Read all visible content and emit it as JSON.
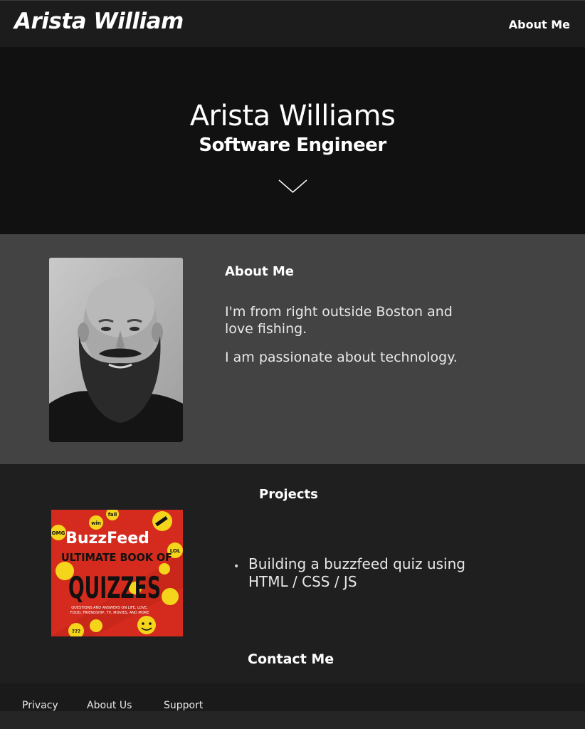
{
  "navbar": {
    "brand": "Arista William",
    "link": "About Me"
  },
  "hero": {
    "name": "Arista Williams",
    "role": "Software Engineer"
  },
  "about": {
    "title": "About Me",
    "paragraph_1": "I'm from right outside Boston and love fishing.",
    "paragraph_2": "I am passionate about technology."
  },
  "projects": {
    "title": "Projects",
    "items": [
      "Building a buzzfeed quiz using HTML / CSS / JS"
    ],
    "book": {
      "brand": "BuzzFeed",
      "line1": "ULTIMATE BOOK OF",
      "line2": "QUIZZES",
      "subtitle_1": "QUESTIONS AND ANSWERS ON LIFE, LOVE,",
      "subtitle_2": "FOOD, FRIENDSHIP, TV, MOVIES, AND MORE",
      "stickers": [
        "win",
        "fail",
        "OMG",
        "LOL",
        "???"
      ]
    }
  },
  "contact": {
    "title": "Contact Me"
  },
  "footer": {
    "links": [
      "Privacy",
      "About Us",
      "Support"
    ]
  },
  "colors": {
    "navbar": "#1c1c1c",
    "hero": "#111111",
    "about": "#434343",
    "projects": "#1f1f1f",
    "book_red": "#d42b1e",
    "sticker_yellow": "#f5d51c"
  }
}
